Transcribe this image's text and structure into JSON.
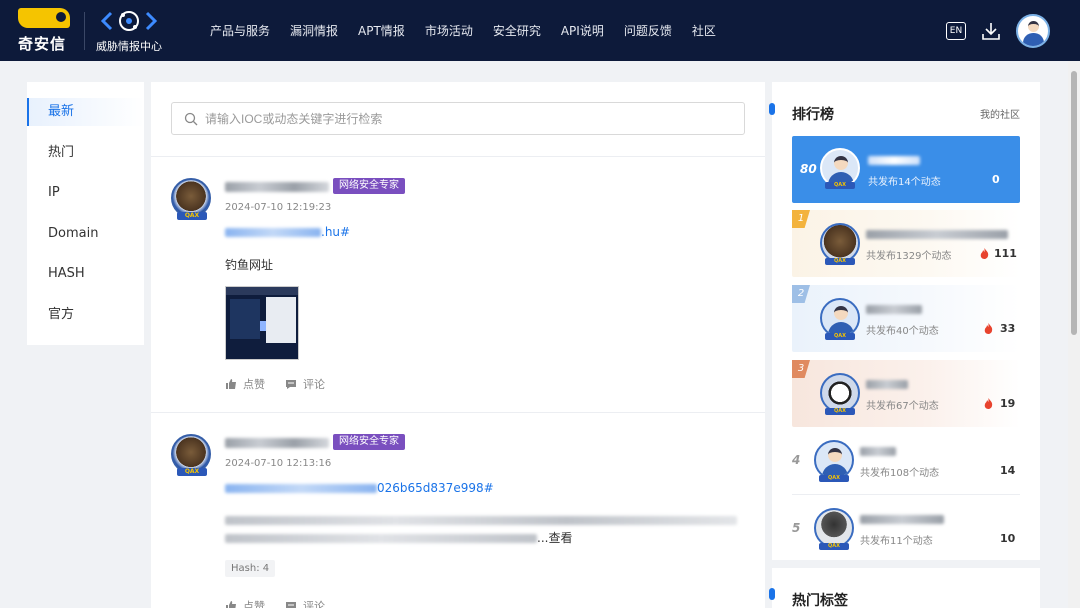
{
  "header": {
    "brand_name": "奇安信",
    "product_name": "威胁情报中心",
    "nav": [
      "产品与服务",
      "漏洞情报",
      "APT情报",
      "市场活动",
      "安全研究",
      "API说明",
      "问题反馈",
      "社区"
    ],
    "lang_label": "EN"
  },
  "sidebar": {
    "items": [
      {
        "label": "最新",
        "active": true
      },
      {
        "label": "热门"
      },
      {
        "label": "IP"
      },
      {
        "label": "Domain"
      },
      {
        "label": "HASH"
      },
      {
        "label": "官方"
      }
    ]
  },
  "search": {
    "placeholder": "请输入IOC或动态关键字进行检索"
  },
  "posts": [
    {
      "tag": "网络安全专家",
      "time": "2024-07-10 12:19:23",
      "link_visible": ".hu#",
      "text": "钓鱼网址",
      "like_label": "点赞",
      "comment_label": "评论",
      "badge": "QAX"
    },
    {
      "tag": "网络安全专家",
      "time": "2024-07-10 12:13:16",
      "link_visible": "026b65d837e998#",
      "text_tail": "...查看",
      "hash_chip": "Hash: 4",
      "like_label": "点赞",
      "comment_label": "评论",
      "badge": "QAX"
    }
  ],
  "ranking": {
    "title": "排行榜",
    "my_community": "我的社区",
    "me": {
      "rank": "80",
      "sub": "共发布14个动态",
      "score": "0"
    },
    "entries": [
      {
        "rank": "1",
        "sub": "共发布1329个动态",
        "score": "111"
      },
      {
        "rank": "2",
        "sub": "共发布40个动态",
        "score": "33"
      },
      {
        "rank": "3",
        "sub": "共发布67个动态",
        "score": "19"
      },
      {
        "rank": "4",
        "sub": "共发布108个动态",
        "score": "14"
      },
      {
        "rank": "5",
        "sub": "共发布11个动态",
        "score": "10"
      }
    ]
  },
  "hot_tags": {
    "title": "热门标签"
  },
  "colors": {
    "header_bg": "#0d1a3a",
    "accent": "#1a73e8",
    "expert_tag": "#7a4fbf",
    "fire": "#e8432e"
  }
}
